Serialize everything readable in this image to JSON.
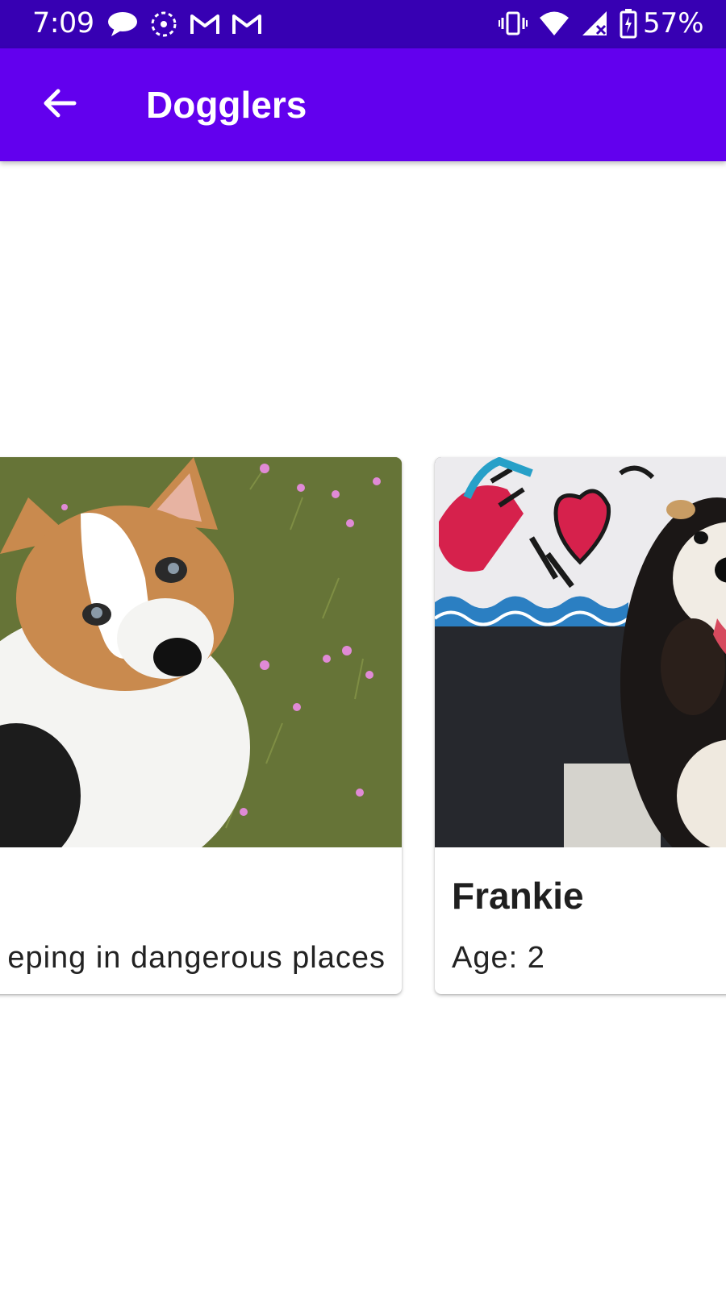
{
  "status_bar": {
    "time": "7:09",
    "battery": "57%",
    "icons_left": [
      "chat-bubble-icon",
      "canvas-icon",
      "gmail-icon",
      "gmail-icon"
    ],
    "icons_right": [
      "vibrate-icon",
      "wifi-icon",
      "signal-icon",
      "battery-charging-icon"
    ]
  },
  "app_bar": {
    "title": "Dogglers",
    "back_icon": "arrow-back-icon",
    "color": "#6200ee"
  },
  "status_bar_color": "#3700b3",
  "cards": [
    {
      "photo": "corgi-photo",
      "name": "",
      "detail": "eping in dangerous places"
    },
    {
      "photo": "bernedoodle-photo",
      "name": "Frankie",
      "detail": "Age: 2"
    }
  ]
}
